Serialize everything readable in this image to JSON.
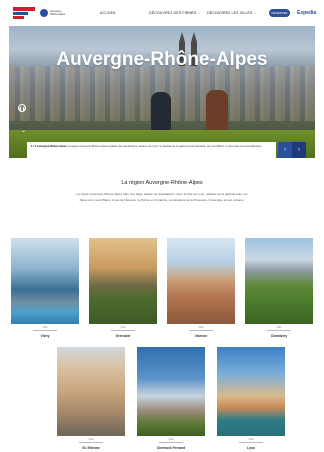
{
  "header": {
    "nav": [
      "ACCUEIL",
      "DÉCOUVREZ DES FIRMES",
      "DÉCOUVREZ LES VILLES"
    ],
    "reserve_label": "RÉSERVEZ",
    "brand_right": "Expedia",
    "partner_text": "Auvergne-Rhône-Alpes",
    "chevron_icon": "chevron-down-icon"
  },
  "hero": {
    "title": "Auvergne-Rhône-Alpes",
    "caption_title": "1 / 6 Auvergne-Rhône-Alpes",
    "caption_text": "La région Auvergne-Rhône-Alpes englobe des destinations variées, de Lyon, la capitale de la gastronomie française, au mont Blanc, le plus haut sommet d'Europe.",
    "pause_icon": "pause-icon",
    "down_icon": "chevron-down-icon",
    "prev_icon": "chevron-left-icon",
    "next_icon": "chevron-right-icon"
  },
  "intro": {
    "title": "La région Auvergne-Rhône-Alpes",
    "text": "La région Auvergne-Rhône-Alpes offre une large palette de destinations, avec la ville de Lyon, capitale de la gastronomie, les Alpes et le mont Blanc, le lac de l'Écosse, la Drôme et l'Ardèche, à invitations de la Provence, l'Auvergne et ses volcans."
  },
  "cities": [
    {
      "tag": "Ville",
      "name": "Vichy"
    },
    {
      "tag": "Ville",
      "name": "Grenoble"
    },
    {
      "tag": "Ville",
      "name": "Valence"
    },
    {
      "tag": "Ville",
      "name": "Chambéry"
    },
    {
      "tag": "Ville",
      "name": "St. Etienne"
    },
    {
      "tag": "Ville",
      "name": "Clermont Ferrand"
    },
    {
      "tag": "Ville",
      "name": "Lyon"
    }
  ],
  "colors": {
    "accent": "#2a4f9d",
    "brand_red": "#d11e2b"
  }
}
